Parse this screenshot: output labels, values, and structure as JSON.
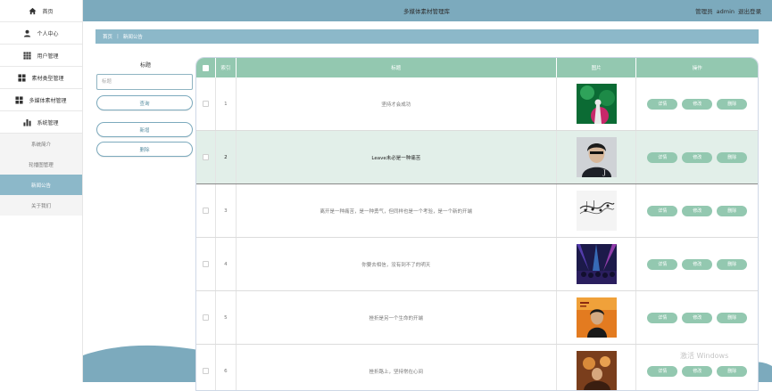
{
  "sidebar": {
    "menu": [
      {
        "label": "首页",
        "icon": "home-icon"
      },
      {
        "label": "个人中心",
        "icon": "user-icon"
      },
      {
        "label": "用户管理",
        "icon": "grid-icon"
      },
      {
        "label": "素材类型管理",
        "icon": "grid-icon"
      },
      {
        "label": "多媒体素材管理",
        "icon": "grid-icon"
      },
      {
        "label": "系统管理",
        "icon": "bar-chart-icon"
      }
    ],
    "submenu": [
      {
        "label": "系统简介",
        "active": false
      },
      {
        "label": "轮播图管理",
        "active": false
      },
      {
        "label": "新闻公告",
        "active": true
      },
      {
        "label": "关于我们",
        "active": false
      }
    ]
  },
  "header": {
    "title": "多媒体素材管理库",
    "role": "管理员",
    "username": "admin",
    "logout": "退出登录"
  },
  "breadcrumb": {
    "home": "首页",
    "separator": "|",
    "current": "新闻公告"
  },
  "filter": {
    "label": "标题",
    "placeholder": "标题",
    "search": "查询",
    "add": "新增",
    "delete": "删除"
  },
  "table": {
    "headers": {
      "index": "索引",
      "title": "标题",
      "image": "图片",
      "ops": "操作"
    },
    "ops": {
      "detail": "详情",
      "edit": "修改",
      "delete": "删除"
    },
    "rows": [
      {
        "index": "1",
        "title": "坚持才会成功",
        "selected": false
      },
      {
        "index": "2",
        "title": "Leave未必是一种痛苦",
        "selected": true
      },
      {
        "index": "3",
        "title": "离开是一种痛苦，是一种勇气，但同样也是一个考验，是一个新的开端",
        "selected": false
      },
      {
        "index": "4",
        "title": "你要去相信，没有到不了的明天",
        "selected": false
      },
      {
        "index": "5",
        "title": "挫折是另一个生命的开端",
        "selected": false
      },
      {
        "index": "6",
        "title": "挫折路上，坚持常在心间",
        "selected": false
      }
    ]
  },
  "watermark": "激活 Windows",
  "colors": {
    "header": "#7caabd",
    "accent": "#93c8b0",
    "active_menu": "#8cb8c9",
    "selected_row": "#e2efe9"
  }
}
